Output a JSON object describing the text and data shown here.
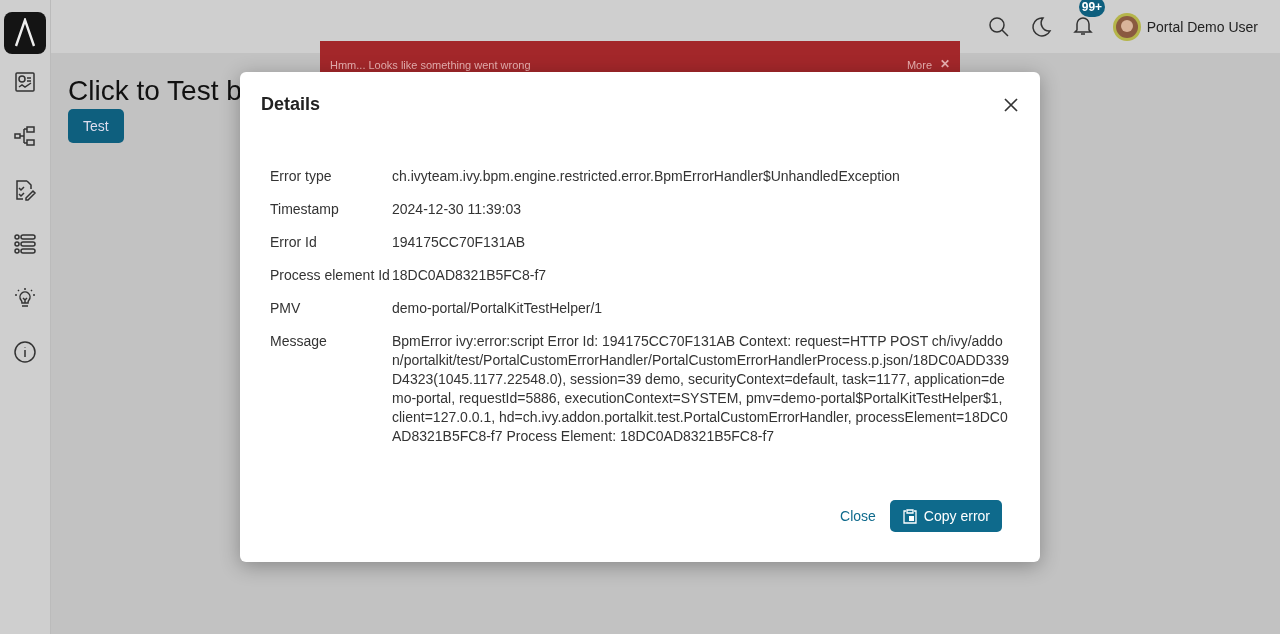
{
  "header": {
    "notification_count": "99+",
    "user_name": "Portal Demo User"
  },
  "page": {
    "heading": "Click to Test b",
    "button": "Test"
  },
  "banner": {
    "message": "Hmm... Looks like something went wrong",
    "more": "More",
    "close": "✕"
  },
  "dialog": {
    "title": "Details",
    "fields": [
      {
        "label": "Error type",
        "value": "ch.ivyteam.ivy.bpm.engine.restricted.error.BpmErrorHandler$UnhandledException"
      },
      {
        "label": "Timestamp",
        "value": "2024-12-30 11:39:03"
      },
      {
        "label": "Error Id",
        "value": "194175CC70F131AB"
      },
      {
        "label": "Process element Id",
        "value": "18DC0AD8321B5FC8-f7"
      },
      {
        "label": "PMV",
        "value": "demo-portal/PortalKitTestHelper/1"
      },
      {
        "label": "Message",
        "value": "BpmError ivy:error:script Error Id: 194175CC70F131AB Context: request=HTTP POST ch/ivy/addon/portalkit/test/PortalCustomErrorHandler/PortalCustomErrorHandlerProcess.p.json/18DC0ADD339D4323(1045.1177.22548.0), session=39 demo, securityContext=default, task=1177, application=demo-portal, requestId=5886, executionContext=SYSTEM, pmv=demo-portal$PortalKitTestHelper$1, client=127.0.0.1, hd=ch.ivy.addon.portalkit.test.PortalCustomErrorHandler, processElement=18DC0AD8321B5FC8-f7 Process Element: 18DC0AD8321B5FC8-f7"
      }
    ],
    "close_link": "Close",
    "copy_button": "Copy error"
  }
}
